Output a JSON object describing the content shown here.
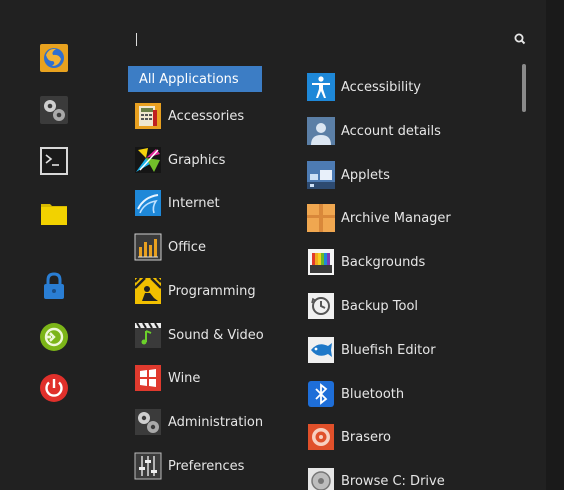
{
  "search": {
    "placeholder": "",
    "value": ""
  },
  "favorites": [
    {
      "icon": "firefox-icon"
    },
    {
      "icon": "system-settings-icon"
    },
    {
      "icon": "terminal-icon"
    },
    {
      "icon": "files-folder-icon"
    },
    {
      "icon": "lock-screen-icon"
    },
    {
      "icon": "logout-icon"
    },
    {
      "icon": "power-icon"
    }
  ],
  "categories": {
    "all": "All Applications",
    "items": [
      {
        "label": "Accessories",
        "icon": "accessories-icon"
      },
      {
        "label": "Graphics",
        "icon": "graphics-icon"
      },
      {
        "label": "Internet",
        "icon": "internet-icon"
      },
      {
        "label": "Office",
        "icon": "office-icon"
      },
      {
        "label": "Programming",
        "icon": "programming-icon"
      },
      {
        "label": "Sound & Video",
        "icon": "sound-video-icon"
      },
      {
        "label": "Wine",
        "icon": "wine-icon"
      },
      {
        "label": "Administration",
        "icon": "administration-icon"
      },
      {
        "label": "Preferences",
        "icon": "preferences-icon"
      }
    ]
  },
  "apps": [
    {
      "label": "Accessibility",
      "icon": "accessibility-icon"
    },
    {
      "label": "Account details",
      "icon": "account-icon"
    },
    {
      "label": "Applets",
      "icon": "applets-icon"
    },
    {
      "label": "Archive Manager",
      "icon": "archive-icon"
    },
    {
      "label": "Backgrounds",
      "icon": "backgrounds-icon"
    },
    {
      "label": "Backup Tool",
      "icon": "backup-icon"
    },
    {
      "label": "Bluefish Editor",
      "icon": "bluefish-icon"
    },
    {
      "label": "Bluetooth",
      "icon": "bluetooth-icon"
    },
    {
      "label": "Brasero",
      "icon": "brasero-icon"
    },
    {
      "label": "Browse C: Drive",
      "icon": "drive-icon"
    }
  ],
  "colors": {
    "accent": "#3c7dc5",
    "background": "#212121",
    "text": "#e6e6e6"
  }
}
